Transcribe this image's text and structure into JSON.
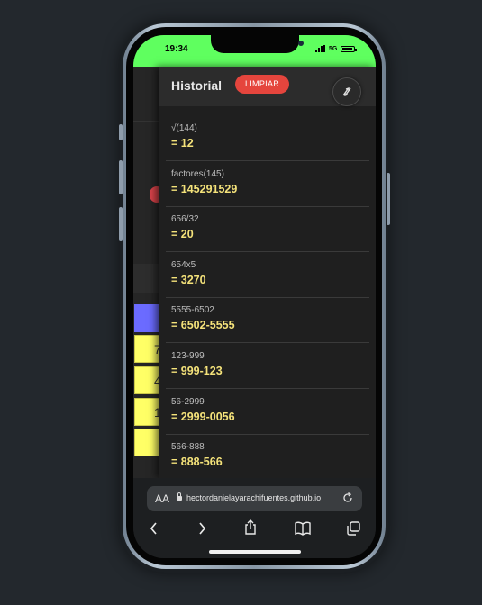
{
  "status_bar": {
    "time": "19:34",
    "network": "5G",
    "battery_fill": 0.9
  },
  "history": {
    "title": "Historial",
    "clear_label": "LIMPIAR",
    "swap_icon": "swap-arrows-icon",
    "entries": [
      {
        "expression": "√(144)",
        "result": "= 12"
      },
      {
        "expression": "factores(145)",
        "result": "= 145291529"
      },
      {
        "expression": "656/32",
        "result": "= 20"
      },
      {
        "expression": "654x5",
        "result": "= 3270"
      },
      {
        "expression": "5555-6502",
        "result": "= 6502-5555"
      },
      {
        "expression": "123-999",
        "result": "= 999-123"
      },
      {
        "expression": "56-2999",
        "result": "= 2999-0056"
      },
      {
        "expression": "566-888",
        "result": "= 888-566"
      }
    ]
  },
  "background_keypad": {
    "keys": [
      "7",
      "4",
      "1",
      ""
    ]
  },
  "browser": {
    "text_size_label": "AA",
    "url": "hectordanielayarachifuentes.github.io",
    "toolbar": [
      "back-icon",
      "forward-icon",
      "share-icon",
      "bookmarks-icon",
      "tabs-icon"
    ]
  },
  "colors": {
    "status_bar": "#5fff5f",
    "clear_button": "#e5453d",
    "result_text": "#f4e27a",
    "keypad_key": "#ffff66",
    "operator_key": "#6b6bff"
  }
}
